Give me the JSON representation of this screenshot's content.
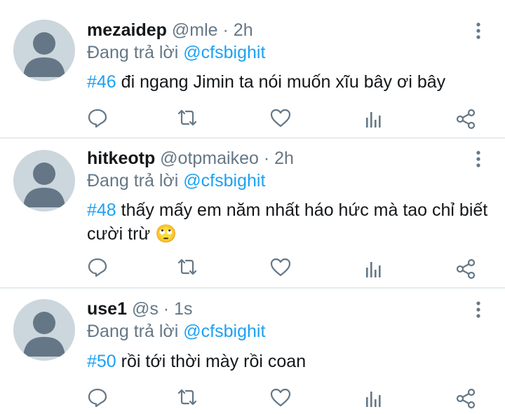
{
  "tweets": [
    {
      "name": "mezaidep",
      "handle": "@mle",
      "separator": "·",
      "time": "2h",
      "reply_prefix": "Đang trả lời",
      "reply_to": "@cfsbighit",
      "hashtag": "#46",
      "text": " đi ngang Jimin ta nói muốn xĩu bây ơi bây",
      "emoji": ""
    },
    {
      "name": "hitkeotp",
      "handle": "@otpmaikeo",
      "separator": "·",
      "time": "2h",
      "reply_prefix": "Đang trả lời",
      "reply_to": "@cfsbighit",
      "hashtag": "#48",
      "text": " thấy mấy em năm nhất háo hức mà tao chỉ biết cười trừ ",
      "emoji": "🙄"
    },
    {
      "name": "use1",
      "handle": "@s",
      "separator": "·",
      "time": "1s",
      "reply_prefix": "Đang trả lời",
      "reply_to": "@cfsbighit",
      "hashtag": "#50",
      "text": " rồi tới thời mày rồi coan",
      "emoji": ""
    }
  ],
  "icons": {
    "reply": "reply-icon",
    "retweet": "retweet-icon",
    "like": "like-icon",
    "analytics": "analytics-icon",
    "share": "share-icon",
    "more": "more-vertical-icon",
    "avatar": "default-avatar"
  },
  "colors": {
    "link": "#1da1f2",
    "secondary": "#657786",
    "icon": "#657786",
    "avatar_bg": "#ccd6dd",
    "avatar_fg": "#657786",
    "divider": "#e6ecf0"
  }
}
